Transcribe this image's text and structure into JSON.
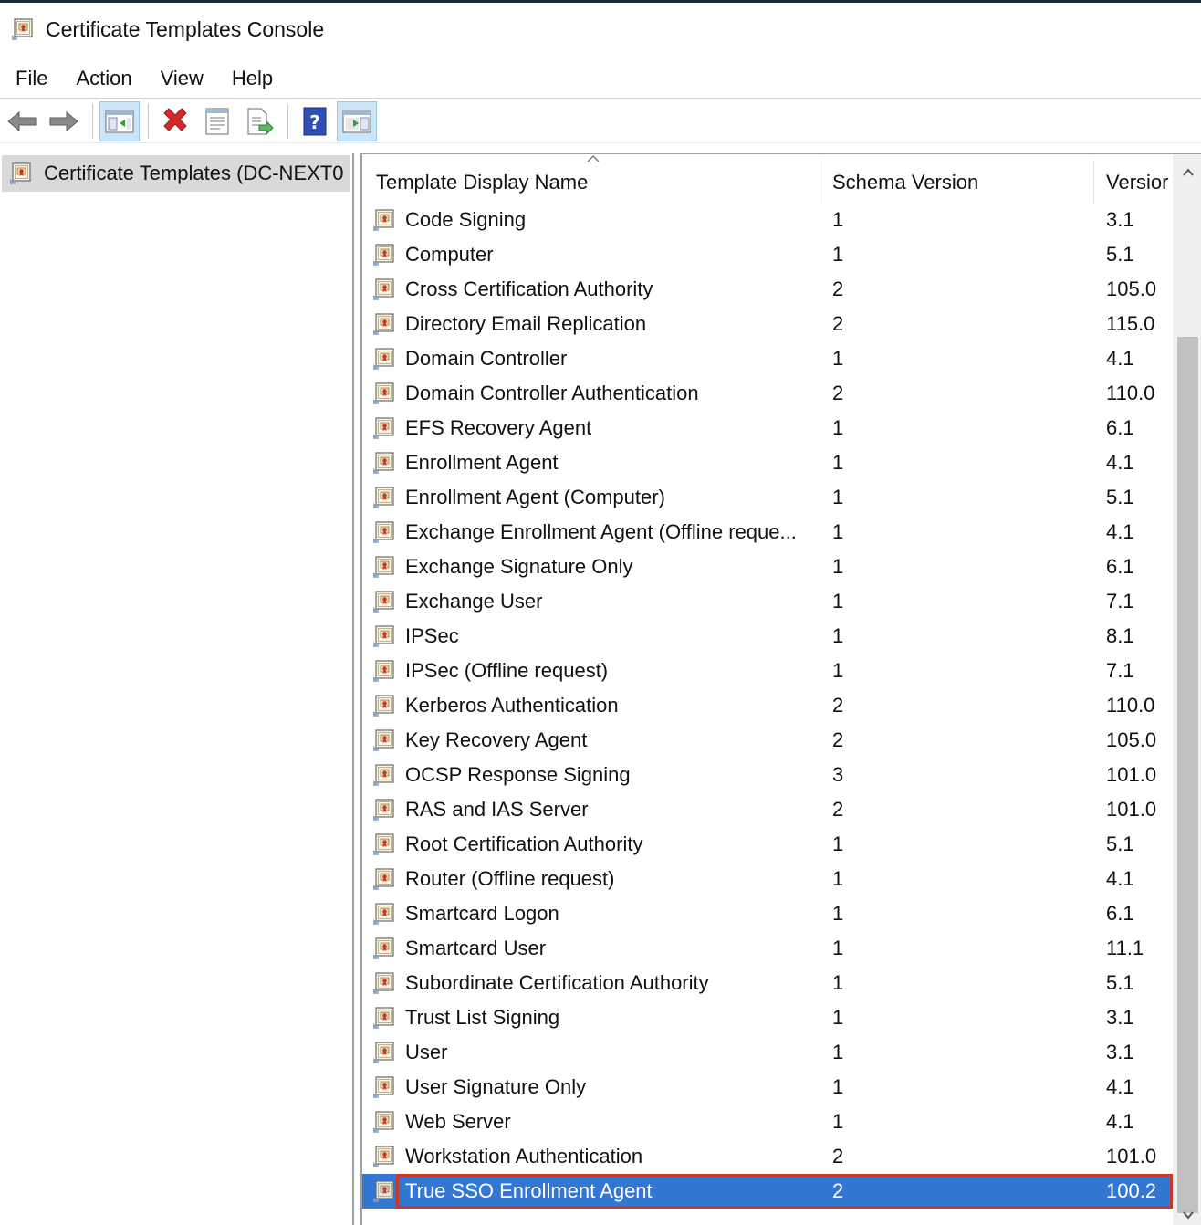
{
  "window": {
    "title": "Certificate Templates Console",
    "icon": "certificate-template-icon"
  },
  "menu": [
    {
      "label": "File"
    },
    {
      "label": "Action"
    },
    {
      "label": "View"
    },
    {
      "label": "Help"
    }
  ],
  "toolbar": {
    "buttons": [
      "back-icon",
      "forward-icon",
      "show-hide-console-tree-icon",
      "delete-icon",
      "properties-icon",
      "export-list-icon",
      "help-icon",
      "show-hide-action-pane-icon"
    ]
  },
  "tree": {
    "root_label": "Certificate Templates (DC-NEXT0"
  },
  "list": {
    "columns": [
      "Template Display Name",
      "Schema Version",
      "Versior"
    ],
    "sort_indicator": "ascending",
    "rows": [
      {
        "name": "Code Signing",
        "schema": "1",
        "version": "3.1"
      },
      {
        "name": "Computer",
        "schema": "1",
        "version": "5.1"
      },
      {
        "name": "Cross Certification Authority",
        "schema": "2",
        "version": "105.0"
      },
      {
        "name": "Directory Email Replication",
        "schema": "2",
        "version": "115.0"
      },
      {
        "name": "Domain Controller",
        "schema": "1",
        "version": "4.1"
      },
      {
        "name": "Domain Controller Authentication",
        "schema": "2",
        "version": "110.0"
      },
      {
        "name": "EFS Recovery Agent",
        "schema": "1",
        "version": "6.1"
      },
      {
        "name": "Enrollment Agent",
        "schema": "1",
        "version": "4.1"
      },
      {
        "name": "Enrollment Agent (Computer)",
        "schema": "1",
        "version": "5.1"
      },
      {
        "name": "Exchange Enrollment Agent (Offline reque...",
        "schema": "1",
        "version": "4.1"
      },
      {
        "name": "Exchange Signature Only",
        "schema": "1",
        "version": "6.1"
      },
      {
        "name": "Exchange User",
        "schema": "1",
        "version": "7.1"
      },
      {
        "name": "IPSec",
        "schema": "1",
        "version": "8.1"
      },
      {
        "name": "IPSec (Offline request)",
        "schema": "1",
        "version": "7.1"
      },
      {
        "name": "Kerberos Authentication",
        "schema": "2",
        "version": "110.0"
      },
      {
        "name": "Key Recovery Agent",
        "schema": "2",
        "version": "105.0"
      },
      {
        "name": "OCSP Response Signing",
        "schema": "3",
        "version": "101.0"
      },
      {
        "name": "RAS and IAS Server",
        "schema": "2",
        "version": "101.0"
      },
      {
        "name": "Root Certification Authority",
        "schema": "1",
        "version": "5.1"
      },
      {
        "name": "Router (Offline request)",
        "schema": "1",
        "version": "4.1"
      },
      {
        "name": "Smartcard Logon",
        "schema": "1",
        "version": "6.1"
      },
      {
        "name": "Smartcard User",
        "schema": "1",
        "version": "11.1"
      },
      {
        "name": "Subordinate Certification Authority",
        "schema": "1",
        "version": "5.1"
      },
      {
        "name": "Trust List Signing",
        "schema": "1",
        "version": "3.1"
      },
      {
        "name": "User",
        "schema": "1",
        "version": "3.1"
      },
      {
        "name": "User Signature Only",
        "schema": "1",
        "version": "4.1"
      },
      {
        "name": "Web Server",
        "schema": "1",
        "version": "4.1"
      },
      {
        "name": "Workstation Authentication",
        "schema": "2",
        "version": "101.0"
      },
      {
        "name": "True SSO Enrollment Agent",
        "schema": "2",
        "version": "100.2",
        "selected": true
      }
    ]
  },
  "colors": {
    "selection": "#3277d1",
    "highlight_outline": "#c8392b",
    "tree_selection": "#d9d9d9"
  }
}
